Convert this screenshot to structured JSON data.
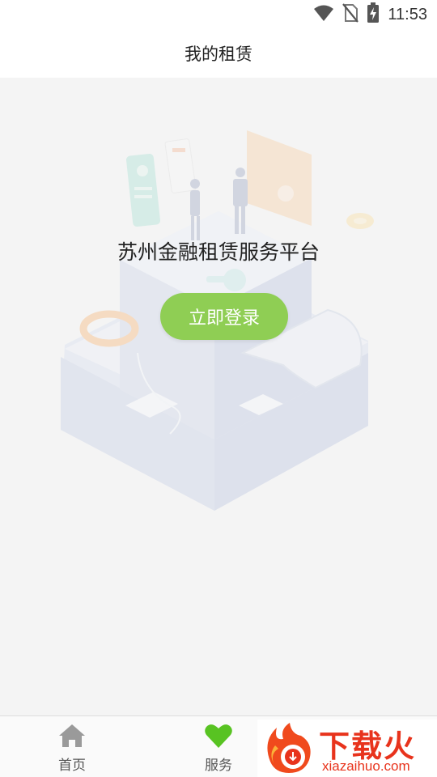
{
  "status_bar": {
    "time": "11:53",
    "icons": [
      "wifi-icon",
      "no-sim-icon",
      "battery-charging-icon"
    ]
  },
  "header": {
    "title": "我的租赁"
  },
  "main": {
    "platform_name": "苏州金融租赁服务平台",
    "login_button": "立即登录",
    "illustration": "isometric-office-illustration"
  },
  "tab_bar": {
    "items": [
      {
        "label": "首页",
        "icon": "home-icon",
        "color": "#9a9a9a"
      },
      {
        "label": "服务",
        "icon": "heart-icon",
        "color": "#58c322"
      }
    ]
  },
  "watermark": {
    "title": "下载火",
    "url": "xiazaihuo.com",
    "color": "#e8331c"
  },
  "colors": {
    "accent": "#8fce54",
    "background": "#f4f4f4"
  }
}
